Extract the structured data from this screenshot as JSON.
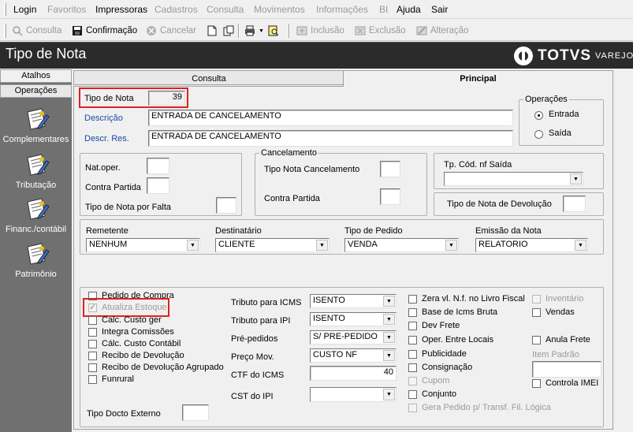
{
  "menu": {
    "login": "Login",
    "favoritos": "Favoritos",
    "impressoras": "Impressoras",
    "cadastros": "Cadastros",
    "consulta": "Consulta",
    "movimentos": "Movimentos",
    "informacoes": "Informações",
    "bi": "BI",
    "ajuda": "Ajuda",
    "sair": "Sair"
  },
  "toolbar": {
    "consulta": "Consulta",
    "confirmacao": "Confirmação",
    "cancelar": "Cancelar",
    "inclusao": "Inclusão",
    "exclusao": "Exclusão",
    "alteracao": "Alteração"
  },
  "window": {
    "title": "Tipo de Nota",
    "brand": "TOTVS",
    "brand_sub": "VAREJO"
  },
  "sidebar": {
    "tabs": [
      "Atalhos",
      "Operações"
    ],
    "items": [
      "Complementares",
      "Tributação",
      "Financ./contábil",
      "Patrimônio"
    ]
  },
  "tabs": {
    "consulta": "Consulta",
    "principal": "Principal"
  },
  "form": {
    "tipo_nota_label": "Tipo de Nota",
    "tipo_nota_value": "39",
    "descricao_label": "Descrição",
    "descricao_value": "ENTRADA DE CANCELAMENTO",
    "descr_res_label": "Descr. Res.",
    "descr_res_value": "ENTRADA DE CANCELAMENTO",
    "operacoes_legend": "Operações",
    "op_entrada": "Entrada",
    "op_saida": "Saída",
    "nat_oper_label": "Nat.oper.",
    "contra_partida_label": "Contra Partida",
    "tipo_nota_falta_label": "Tipo de Nota por Falta",
    "cancelamento_legend": "Cancelamento",
    "tipo_nota_cancel_label": "Tipo Nota Cancelamento",
    "cancel_contra_partida_label": "Contra Partida",
    "tp_cod_nf_saida_label": "Tp. Cód. nf Saída",
    "tp_cod_nf_saida_value": "",
    "tipo_nota_devolucao_label": "Tipo de Nota de Devolução",
    "remetente_label": "Remetente",
    "remetente_value": "NENHUM",
    "destinatario_label": "Destinatário",
    "destinatario_value": "CLIENTE",
    "tipo_pedido_label": "Tipo de Pedido",
    "tipo_pedido_value": "VENDA",
    "emissao_label": "Emissão da Nota",
    "emissao_value": "RELATORIO"
  },
  "checks_left": [
    {
      "label": "Pedido de Compra",
      "checked": false,
      "disabled": false
    },
    {
      "label": "Atualiza Estoque",
      "checked": true,
      "disabled": true
    },
    {
      "label": "Calc. Custo ger",
      "checked": false,
      "disabled": false
    },
    {
      "label": "Integra Comissões",
      "checked": false,
      "disabled": false
    },
    {
      "label": "Cálc. Custo Contábil",
      "checked": false,
      "disabled": false
    },
    {
      "label": "Recibo de Devolução",
      "checked": false,
      "disabled": false
    },
    {
      "label": "Recibo de Devolução Agrupado",
      "checked": false,
      "disabled": false
    },
    {
      "label": "Funrural",
      "checked": false,
      "disabled": false
    }
  ],
  "tipo_docto_externo_label": "Tipo Docto Externo",
  "tributos": {
    "icms_label": "Tributo para ICMS",
    "icms_value": "ISENTO",
    "ipi_label": "Tributo para IPI",
    "ipi_value": "ISENTO",
    "pre_pedidos_label": "Pré-pedidos",
    "pre_pedidos_value": "S/ PRE-PEDIDO",
    "preco_mov_label": "Preço Mov.",
    "preco_mov_value": "CUSTO NF",
    "ctf_icms_label": "CTF do ICMS",
    "ctf_icms_value": "40",
    "cst_ipi_label": "CST do IPI",
    "cst_ipi_value": ""
  },
  "checks_mid": [
    {
      "label": "Zera vl. N.f. no Livro Fiscal",
      "checked": false,
      "disabled": false
    },
    {
      "label": "Base de Icms Bruta",
      "checked": false,
      "disabled": false
    },
    {
      "label": "Dev Frete",
      "checked": false,
      "disabled": false
    },
    {
      "label": "Oper. Entre Locais",
      "checked": false,
      "disabled": false
    },
    {
      "label": "Publicidade",
      "checked": false,
      "disabled": false
    },
    {
      "label": "Consignação",
      "checked": false,
      "disabled": false
    },
    {
      "label": "Cupom",
      "checked": false,
      "disabled": true
    },
    {
      "label": "Conjunto",
      "checked": false,
      "disabled": false
    },
    {
      "label": "Gera Pedido p/ Transf. Fil. Lógica",
      "checked": false,
      "disabled": true
    }
  ],
  "checks_right": {
    "inventario": "Inventário",
    "vendas": "Vendas",
    "anula_frete": "Anula Frete",
    "item_padrao_label": "Item Padrão",
    "controla_imei": "Controla IMEI"
  }
}
